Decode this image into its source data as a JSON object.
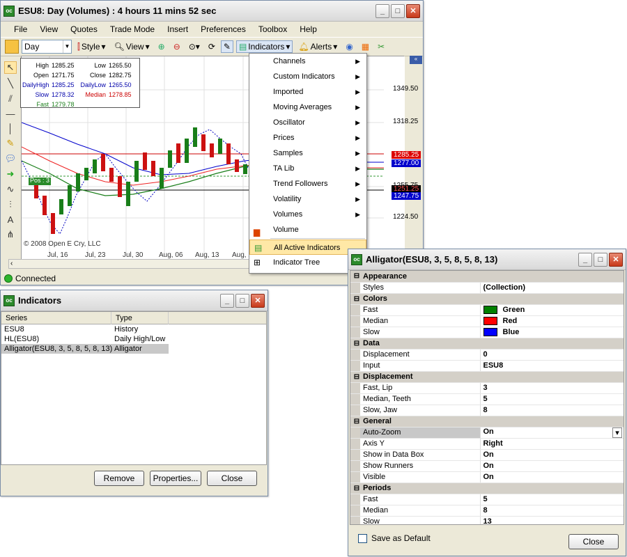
{
  "main_window": {
    "title": "ESU8: Day (Volumes) : 4 hours 11 mins 52 sec",
    "menu": [
      "File",
      "View",
      "Quotes",
      "Trade Mode",
      "Insert",
      "Preferences",
      "Toolbox",
      "Help"
    ],
    "toolbar": {
      "period_select": "Day",
      "style": "Style",
      "view": "View",
      "indicators": "Indicators",
      "alerts": "Alerts"
    },
    "status": "Connected"
  },
  "data_box": {
    "rows": [
      {
        "k1": "High",
        "v1": "1285.25",
        "k2": "Low",
        "v2": "1265.50"
      },
      {
        "k1": "Open",
        "v1": "1271.75",
        "k2": "Close",
        "v2": "1282.75"
      },
      {
        "k1": "DailyHigh",
        "v1": "1285.25",
        "k2": "DailyLow",
        "v2": "1265.50"
      },
      {
        "k1": "Slow",
        "v1": "1278.32",
        "k2": "Median",
        "v2": "1278.85"
      },
      {
        "k1": "Fast",
        "v1": "1279.78",
        "k2": "",
        "v2": ""
      }
    ]
  },
  "chart": {
    "copyright": "© 2008 Open E Cry, LLC",
    "pos_label": "Pos : 3",
    "y_ticks": [
      "1349.50",
      "1318.25",
      "1255.75",
      "1224.50"
    ],
    "x_ticks": [
      "Jul, 16",
      "Jul, 23",
      "Jul, 30",
      "Aug, 06",
      "Aug, 13",
      "Aug, 2"
    ],
    "price_labels": [
      "1285.25",
      "1277.00",
      "1251.25",
      "1247.75"
    ]
  },
  "indicators_menu": {
    "items": [
      {
        "label": "Channels",
        "sub": true
      },
      {
        "label": "Custom Indicators",
        "sub": true
      },
      {
        "label": "Imported",
        "sub": true
      },
      {
        "label": "Moving Averages",
        "sub": true
      },
      {
        "label": "Oscillator",
        "sub": true
      },
      {
        "label": "Prices",
        "sub": true
      },
      {
        "label": "Samples",
        "sub": true
      },
      {
        "label": "TA Lib",
        "sub": true
      },
      {
        "label": "Trend Followers",
        "sub": true
      },
      {
        "label": "Volatility",
        "sub": true
      },
      {
        "label": "Volumes",
        "sub": true
      },
      {
        "label": "Volume",
        "sub": false
      }
    ],
    "active": "All Active Indicators",
    "tree": "Indicator Tree"
  },
  "indicators_window": {
    "title": "Indicators",
    "columns": [
      "Series",
      "Type"
    ],
    "rows": [
      {
        "series": "ESU8",
        "type": "History"
      },
      {
        "series": "HL(ESU8)",
        "type": "Daily High/Low"
      },
      {
        "series": "Alligator(ESU8, 3, 5, 8, 5, 8, 13)",
        "type": "Alligator"
      }
    ],
    "buttons": [
      "Remove",
      "Properties...",
      "Close"
    ]
  },
  "alligator_window": {
    "title": "Alligator(ESU8, 3, 5, 8, 5, 8, 13)",
    "sections": [
      {
        "name": "Appearance",
        "props": [
          {
            "k": "Styles",
            "v": "(Collection)"
          }
        ]
      },
      {
        "name": "Colors",
        "props": [
          {
            "k": "Fast",
            "v": "Green",
            "color": "#008000"
          },
          {
            "k": "Median",
            "v": "Red",
            "color": "#ff0000"
          },
          {
            "k": "Slow",
            "v": "Blue",
            "color": "#0000ff"
          }
        ]
      },
      {
        "name": "Data",
        "props": [
          {
            "k": "Displacement",
            "v": "0"
          },
          {
            "k": "Input",
            "v": "ESU8"
          }
        ]
      },
      {
        "name": "Displacement",
        "props": [
          {
            "k": "Fast, Lip",
            "v": "3"
          },
          {
            "k": "Median, Teeth",
            "v": "5"
          },
          {
            "k": "Slow, Jaw",
            "v": "8"
          }
        ]
      },
      {
        "name": "General",
        "props": [
          {
            "k": "Auto-Zoom",
            "v": "On"
          },
          {
            "k": "Axis Y",
            "v": "Right"
          },
          {
            "k": "Show in Data Box",
            "v": "On"
          },
          {
            "k": "Show Runners",
            "v": "On"
          },
          {
            "k": "Visible",
            "v": "On"
          }
        ]
      },
      {
        "name": "Periods",
        "props": [
          {
            "k": "Fast",
            "v": "5"
          },
          {
            "k": "Median",
            "v": "8"
          },
          {
            "k": "Slow",
            "v": "13"
          }
        ]
      }
    ],
    "save_default": "Save as Default",
    "close": "Close"
  }
}
